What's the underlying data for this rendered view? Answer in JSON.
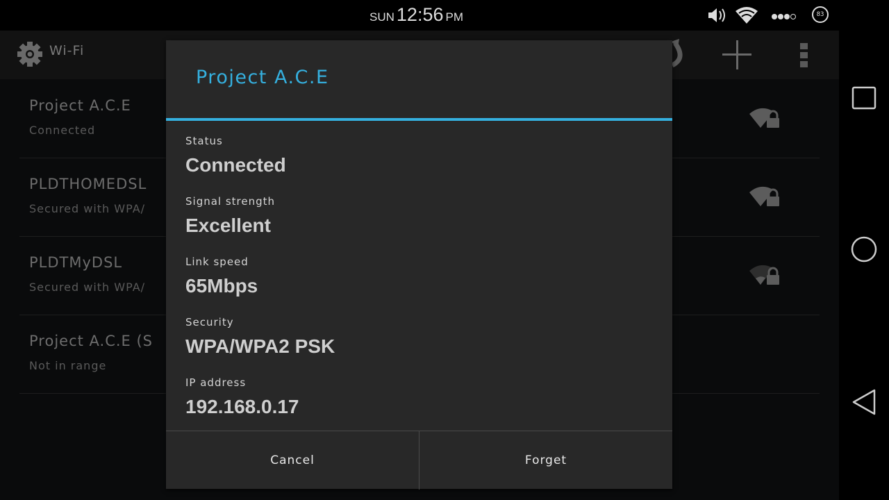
{
  "status_bar": {
    "day": "SUN",
    "time": "12:56",
    "ampm": "PM",
    "battery_level": "83",
    "icons": [
      "volume-icon",
      "wifi-signal-icon",
      "cell-signal-icon",
      "battery-icon"
    ]
  },
  "action_bar": {
    "title": "Wi-Fi",
    "icons": [
      "settings-gear-icon",
      "wps-icon",
      "add-network-icon",
      "overflow-menu-icon"
    ]
  },
  "networks": [
    {
      "name": "Project A.C.E",
      "status": "Connected",
      "signal_bars": 4,
      "secured": true
    },
    {
      "name": "PLDTHOMEDSL",
      "status": "Secured with WPA/",
      "signal_bars": 4,
      "secured": true
    },
    {
      "name": "PLDTMyDSL",
      "status": "Secured with WPA/",
      "signal_bars": 1,
      "secured": true
    },
    {
      "name": "Project A.C.E (S",
      "status": "Not in range",
      "signal_bars": 0,
      "secured": false
    }
  ],
  "dialog": {
    "title": "Project A.C.E",
    "fields": [
      {
        "label": "Status",
        "value": "Connected"
      },
      {
        "label": "Signal strength",
        "value": "Excellent"
      },
      {
        "label": "Link speed",
        "value": "65Mbps"
      },
      {
        "label": "Security",
        "value": "WPA/WPA2 PSK"
      },
      {
        "label": "IP address",
        "value": "192.168.0.17"
      }
    ],
    "cancel_label": "Cancel",
    "forget_label": "Forget"
  },
  "nav_bar": {
    "buttons": [
      "recent-apps",
      "home",
      "back"
    ]
  },
  "colors": {
    "accent": "#35b0df",
    "dialog_bg": "#282828",
    "app_bg": "#0a0b0c"
  }
}
